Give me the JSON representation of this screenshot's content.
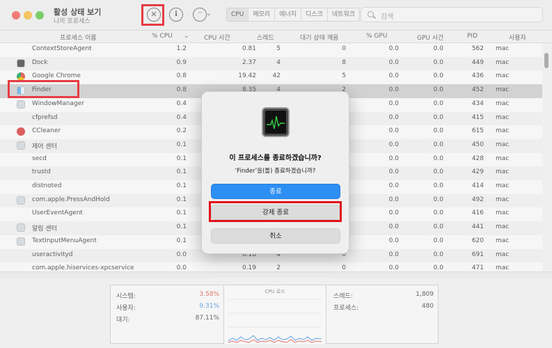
{
  "window": {
    "title": "활성 상태 보기",
    "subtitle": "나의 프로세스"
  },
  "toolbar": {
    "stop_icon": "x-circle-icon",
    "info_icon": "info-icon",
    "more_icon": "ellipsis-icon",
    "more_glyph": "···",
    "chevron_glyph": "⌄",
    "tabs": [
      "CPU",
      "메모리",
      "에너지",
      "디스크",
      "네트워크"
    ],
    "selected_tab": "CPU",
    "search_placeholder": "검색"
  },
  "columns": [
    "프로세스 이름",
    "% CPU",
    "CPU 시간",
    "스레드",
    "대기 상태 깨움",
    "% GPU",
    "GPU 시간",
    "PID",
    "사용자"
  ],
  "sort_indicator": "⌄",
  "processes": [
    {
      "name": "ContextStoreAgent",
      "icon": "none",
      "cpu": "1.2",
      "time": "0.81",
      "threads": "5",
      "wakeups": "0",
      "gpu": "0.0",
      "gputime": "0.0",
      "pid": "562",
      "user": "mac"
    },
    {
      "name": "Dock",
      "icon": "dock",
      "cpu": "0.9",
      "time": "2.37",
      "threads": "4",
      "wakeups": "8",
      "gpu": "0.0",
      "gputime": "0.0",
      "pid": "449",
      "user": "mac"
    },
    {
      "name": "Google Chrome",
      "icon": "chrome",
      "cpu": "0.8",
      "time": "19.42",
      "threads": "42",
      "wakeups": "5",
      "gpu": "0.0",
      "gputime": "0.0",
      "pid": "436",
      "user": "mac"
    },
    {
      "name": "Finder",
      "icon": "finder",
      "cpu": "0.8",
      "time": "8.35",
      "threads": "4",
      "wakeups": "2",
      "gpu": "0.0",
      "gputime": "0.0",
      "pid": "452",
      "user": "mac"
    },
    {
      "name": "WindowManager",
      "icon": "generic",
      "cpu": "0.4",
      "time": "",
      "threads": "",
      "wakeups": "",
      "gpu": "0.0",
      "gputime": "0.0",
      "pid": "434",
      "user": "mac"
    },
    {
      "name": "cfprefsd",
      "icon": "none",
      "cpu": "0.4",
      "time": "",
      "threads": "",
      "wakeups": "",
      "gpu": "0.0",
      "gputime": "0.0",
      "pid": "415",
      "user": "mac"
    },
    {
      "name": "CCleaner",
      "icon": "cc",
      "cpu": "0.2",
      "time": "",
      "threads": "",
      "wakeups": "",
      "gpu": "0.0",
      "gputime": "0.0",
      "pid": "615",
      "user": "mac"
    },
    {
      "name": "제어 센터",
      "icon": "generic",
      "cpu": "0.1",
      "time": "",
      "threads": "",
      "wakeups": "",
      "gpu": "0.0",
      "gputime": "0.0",
      "pid": "450",
      "user": "mac"
    },
    {
      "name": "secd",
      "icon": "none",
      "cpu": "0.1",
      "time": "",
      "threads": "",
      "wakeups": "",
      "gpu": "0.0",
      "gputime": "0.0",
      "pid": "428",
      "user": "mac"
    },
    {
      "name": "trustd",
      "icon": "none",
      "cpu": "0.1",
      "time": "",
      "threads": "",
      "wakeups": "",
      "gpu": "0.0",
      "gputime": "0.0",
      "pid": "429",
      "user": "mac"
    },
    {
      "name": "distnoted",
      "icon": "none",
      "cpu": "0.1",
      "time": "",
      "threads": "",
      "wakeups": "",
      "gpu": "0.0",
      "gputime": "0.0",
      "pid": "414",
      "user": "mac"
    },
    {
      "name": "com.apple.PressAndHold",
      "icon": "generic",
      "cpu": "0.1",
      "time": "",
      "threads": "",
      "wakeups": "",
      "gpu": "0.0",
      "gputime": "0.0",
      "pid": "492",
      "user": "mac"
    },
    {
      "name": "UserEventAgent",
      "icon": "none",
      "cpu": "0.1",
      "time": "",
      "threads": "",
      "wakeups": "",
      "gpu": "0.0",
      "gputime": "0.0",
      "pid": "416",
      "user": "mac"
    },
    {
      "name": "알림 센터",
      "icon": "generic",
      "cpu": "0.1",
      "time": "",
      "threads": "",
      "wakeups": "",
      "gpu": "0.0",
      "gputime": "0.0",
      "pid": "441",
      "user": "mac"
    },
    {
      "name": "TextInputMenuAgent",
      "icon": "generic",
      "cpu": "0.1",
      "time": "",
      "threads": "",
      "wakeups": "",
      "gpu": "0.0",
      "gputime": "0.0",
      "pid": "620",
      "user": "mac"
    },
    {
      "name": "useractivityd",
      "icon": "none",
      "cpu": "0.0",
      "time": "0.18",
      "threads": "4",
      "wakeups": "0",
      "gpu": "0.0",
      "gputime": "0.0",
      "pid": "691",
      "user": "mac"
    },
    {
      "name": "com.apple.hiservices-xpcservice",
      "icon": "none",
      "cpu": "0.0",
      "time": "0.19",
      "threads": "2",
      "wakeups": "0",
      "gpu": "0.0",
      "gputime": "0.0",
      "pid": "471",
      "user": "mac"
    }
  ],
  "selected_process": "Finder",
  "stats": {
    "system_label": "시스템:",
    "system_value": "3.58%",
    "system_color": "#e0554d",
    "user_label": "사용자:",
    "user_value": "9.31%",
    "user_color": "#3d8fe0",
    "idle_label": "대기:",
    "idle_value": "87.11%",
    "cpu_load_title": "CPU 로드",
    "threads_label": "스레드:",
    "threads_value": "1,809",
    "processes_label": "프로세스:",
    "processes_value": "480"
  },
  "dialog": {
    "app_icon": "activity-monitor-icon",
    "title": "이 프로세스를 종료하겠습니까?",
    "message": "‘Finder’을(를) 종료하겠습니까?",
    "quit_button": "종료",
    "force_quit_button": "강제 종료",
    "cancel_button": "취소",
    "accent": "#2d8ff4"
  },
  "highlight_color": "#e1121b"
}
